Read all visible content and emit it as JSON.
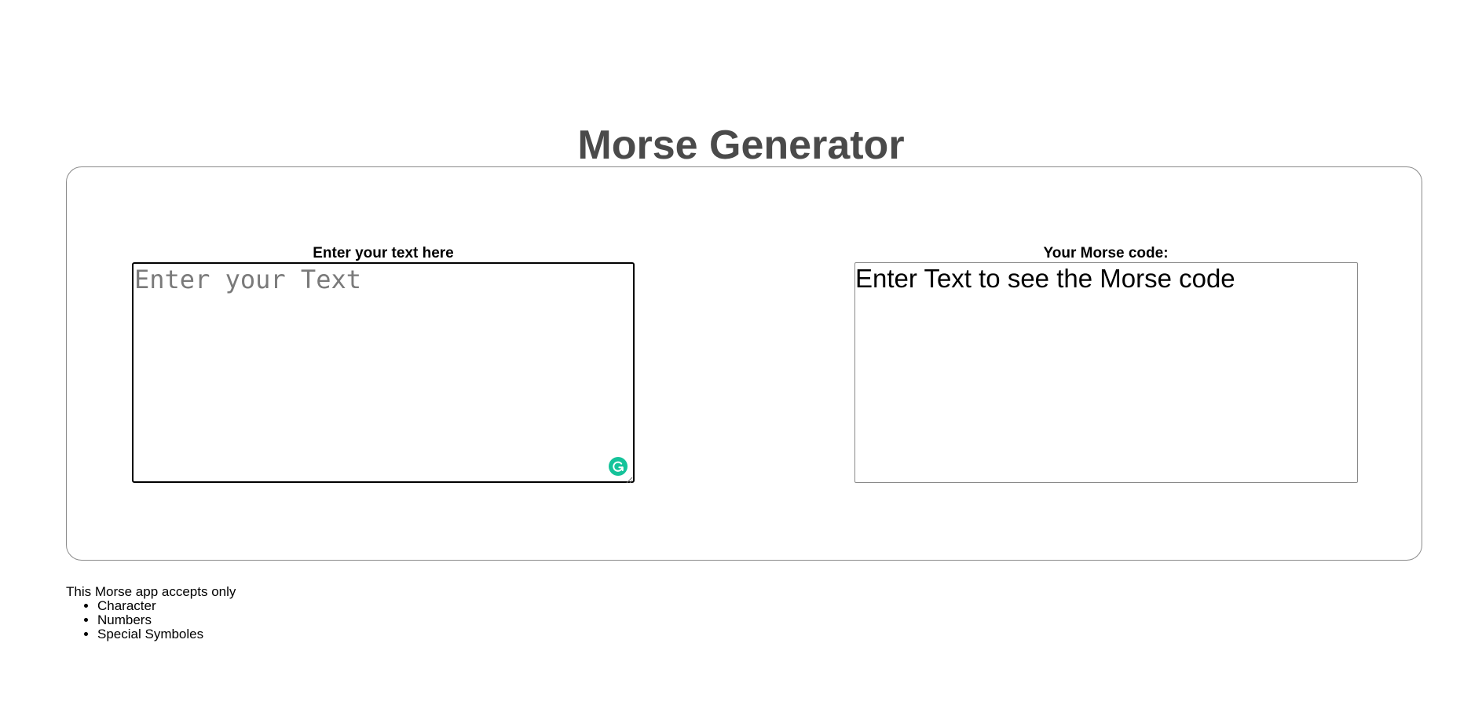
{
  "header": {
    "title": "Morse Generator"
  },
  "input_panel": {
    "label": "Enter your text here",
    "placeholder": "Enter your Text",
    "value": ""
  },
  "output_panel": {
    "label": "Your Morse code:",
    "value": "Enter Text to see the Morse code"
  },
  "info": {
    "intro": "This Morse app accepts only",
    "items": [
      "Character",
      "Numbers",
      "Special Symboles"
    ]
  },
  "icons": {
    "grammar_checker": "grammar-assistant-icon",
    "resize": "resize-handle-icon"
  },
  "colors": {
    "title": "#4a4a4a",
    "card_border": "#8a8a8a",
    "grammar_icon": "#15c39a"
  }
}
